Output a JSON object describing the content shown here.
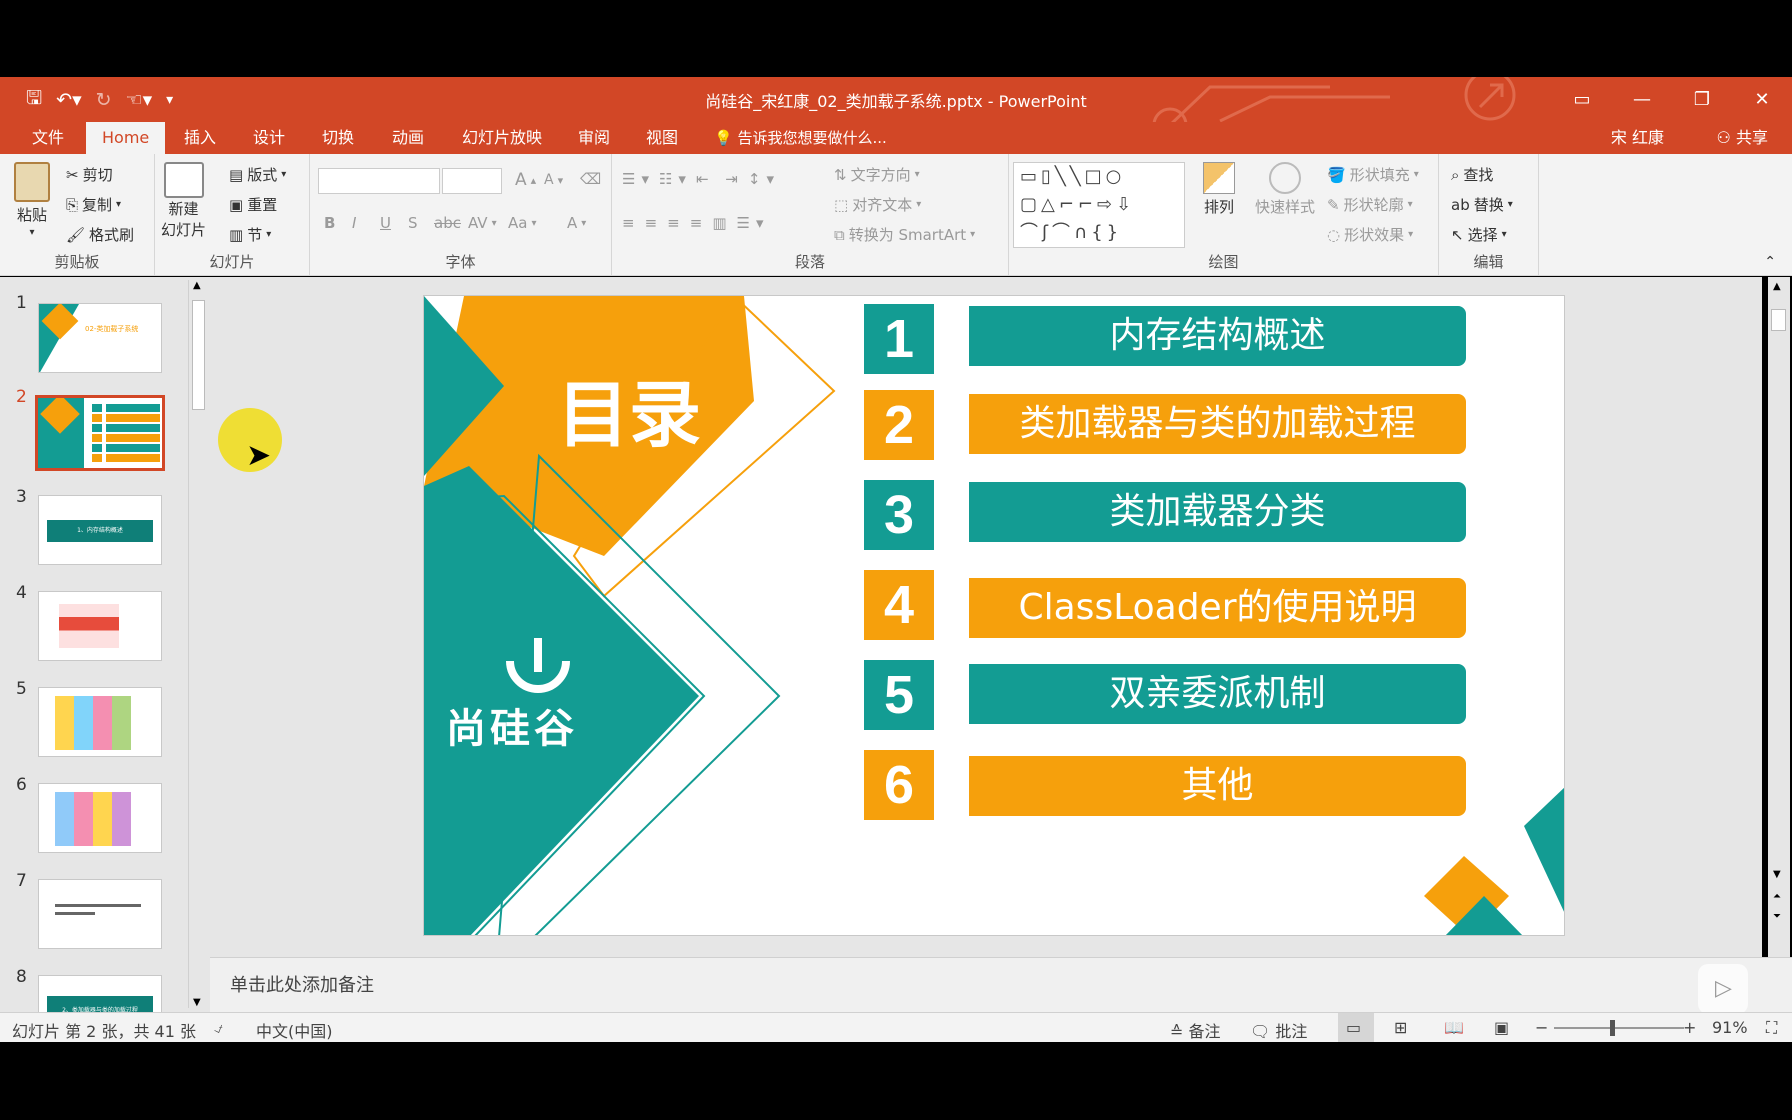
{
  "window": {
    "title": "尚硅谷_宋红康_02_类加载子系统.pptx - PowerPoint"
  },
  "tabs": {
    "file": "文件",
    "home": "Home",
    "insert": "插入",
    "design": "设计",
    "transitions": "切换",
    "animations": "动画",
    "slideshow": "幻灯片放映",
    "review": "审阅",
    "view": "视图",
    "tell_me": "告诉我您想要做什么...",
    "user": "宋 红康",
    "share": "共享"
  },
  "ribbon": {
    "clipboard": {
      "paste": "粘贴",
      "cut": "剪切",
      "copy": "复制",
      "format_painter": "格式刷",
      "label": "剪贴板"
    },
    "slides": {
      "new_slide_1": "新建",
      "new_slide_2": "幻灯片",
      "layout": "版式",
      "reset": "重置",
      "section": "节",
      "label": "幻灯片"
    },
    "font": {
      "bold": "B",
      "italic": "I",
      "underline": "U",
      "shadow": "S",
      "strike": "abc",
      "spacing": "AV",
      "case": "Aa",
      "color": "A",
      "grow": "A",
      "shrink": "A",
      "label": "字体"
    },
    "paragraph": {
      "text_direction": "文字方向",
      "align_text": "对齐文本",
      "smartart": "转换为 SmartArt",
      "label": "段落"
    },
    "drawing": {
      "arrange": "排列",
      "quick_styles": "快速样式",
      "shape_fill": "形状填充",
      "shape_outline": "形状轮廓",
      "shape_effects": "形状效果",
      "label": "绘图"
    },
    "editing": {
      "find": "查找",
      "replace": "替换",
      "select": "选择",
      "label": "编辑"
    }
  },
  "thumbnails": [
    {
      "num": "1",
      "caption": "02-类加载子系统"
    },
    {
      "num": "2",
      "caption": ""
    },
    {
      "num": "3",
      "caption": "1、内存结构概述"
    },
    {
      "num": "4",
      "caption": ""
    },
    {
      "num": "5",
      "caption": ""
    },
    {
      "num": "6",
      "caption": ""
    },
    {
      "num": "7",
      "caption": ""
    },
    {
      "num": "8",
      "caption": "2、类加载器与类的加载过程"
    }
  ],
  "slide": {
    "heading": "目录",
    "logo_text": "尚硅谷",
    "items": [
      {
        "num": "1",
        "label": "内存结构概述",
        "color": "#139c93"
      },
      {
        "num": "2",
        "label": "类加载器与类的加载过程",
        "color": "#f6a00c"
      },
      {
        "num": "3",
        "label": "类加载器分类",
        "color": "#139c93"
      },
      {
        "num": "4",
        "label": "ClassLoader的使用说明",
        "color": "#f6a00c"
      },
      {
        "num": "5",
        "label": "双亲委派机制",
        "color": "#139c93"
      },
      {
        "num": "6",
        "label": "其他",
        "color": "#f6a00c"
      }
    ]
  },
  "notes": {
    "placeholder": "单击此处添加备注"
  },
  "status": {
    "slide_info": "幻灯片 第 2 张，共 41 张",
    "language": "中文(中国)",
    "notes": "备注",
    "comments": "批注",
    "zoom": "91%"
  },
  "colors": {
    "accent": "#d24726",
    "teal": "#139c93",
    "orange": "#f6a00c"
  }
}
